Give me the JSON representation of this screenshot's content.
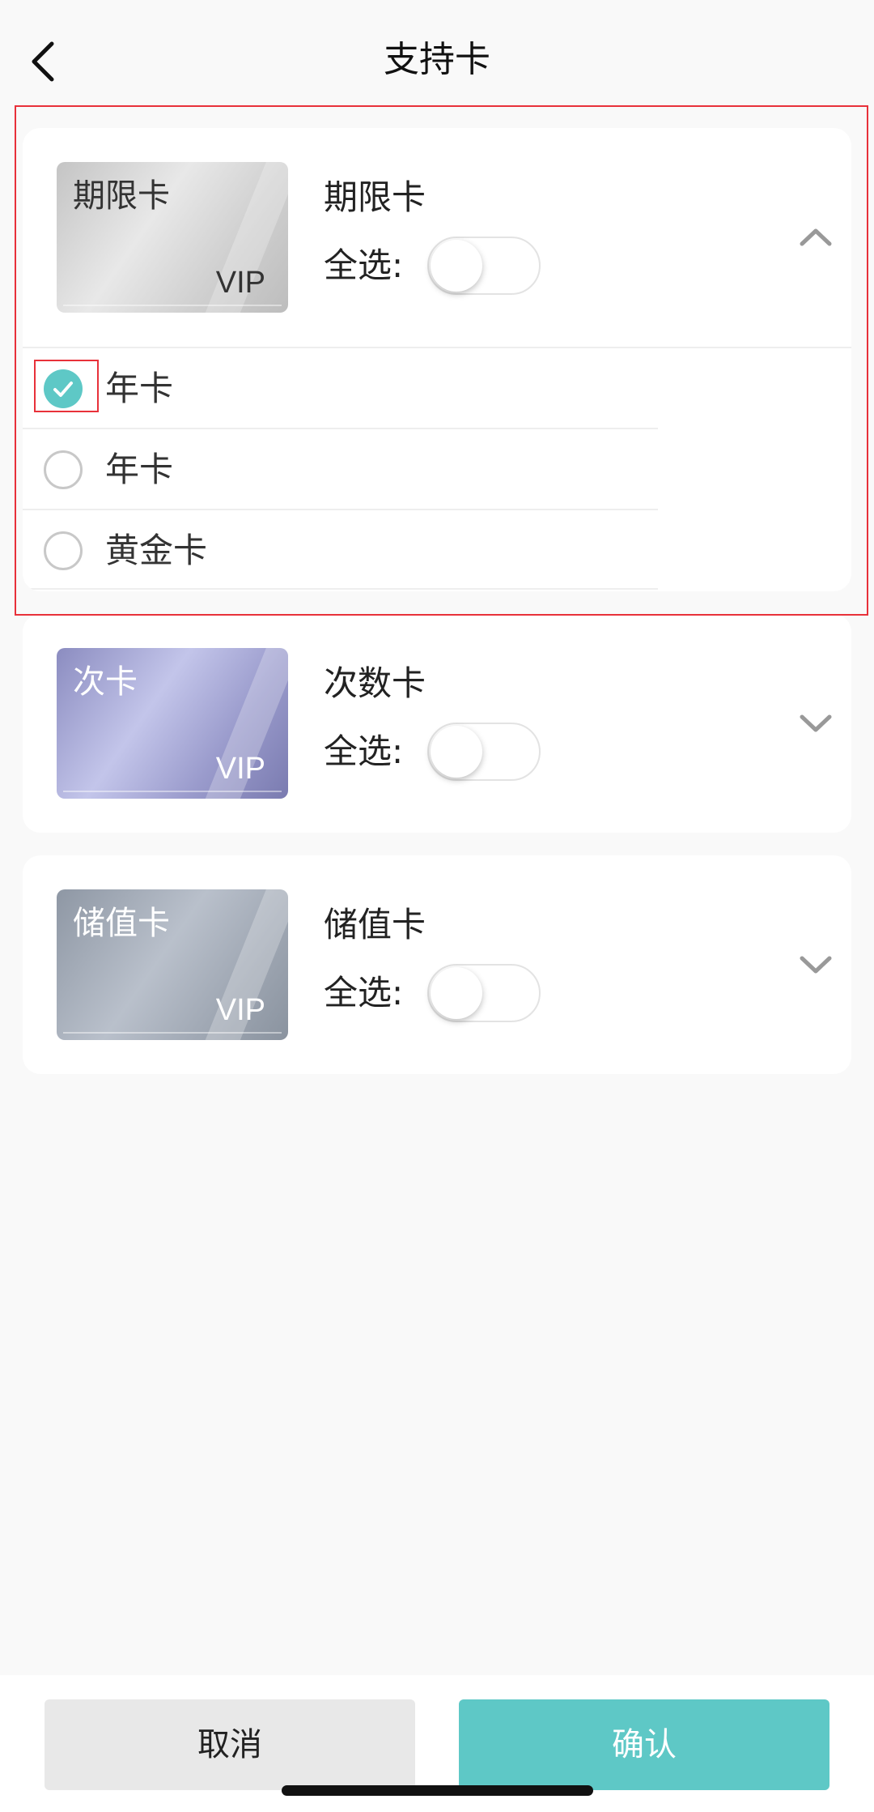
{
  "header": {
    "title": "支持卡",
    "back_icon": "chevron-left-icon"
  },
  "groups": [
    {
      "name": "期限卡",
      "card_tag": "期限卡",
      "card_vip": "VIP",
      "card_color": "silver",
      "select_all_label": "全选:",
      "select_all_on": false,
      "expanded": true,
      "items": [
        {
          "label": "年卡",
          "checked": true
        },
        {
          "label": "年卡",
          "checked": false
        },
        {
          "label": "黄金卡",
          "checked": false
        }
      ]
    },
    {
      "name": "次数卡",
      "card_tag": "次卡",
      "card_vip": "VIP",
      "card_color": "purple",
      "select_all_label": "全选:",
      "select_all_on": false,
      "expanded": false
    },
    {
      "name": "储值卡",
      "card_tag": "储值卡",
      "card_vip": "VIP",
      "card_color": "gray",
      "select_all_label": "全选:",
      "select_all_on": false,
      "expanded": false
    }
  ],
  "footer": {
    "cancel_label": "取消",
    "confirm_label": "确认"
  },
  "colors": {
    "accent": "#5ec8c6",
    "highlight": "#e8313a",
    "background": "#f9f9f9"
  }
}
